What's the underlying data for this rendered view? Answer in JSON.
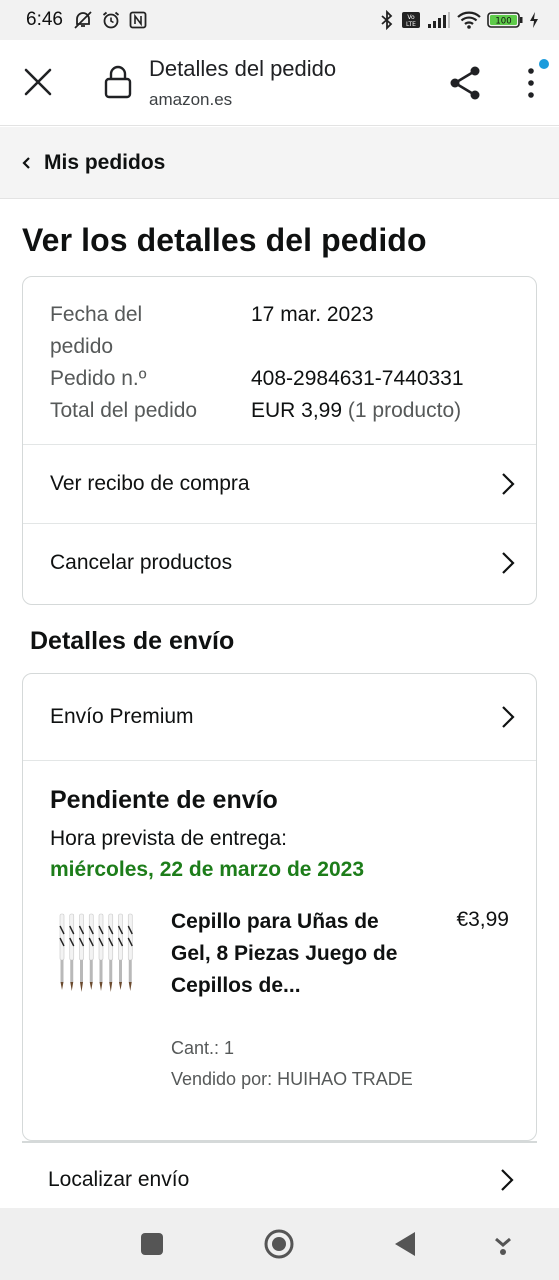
{
  "status_bar": {
    "time": "6:46",
    "battery": "100",
    "icons_left": [
      "mute-icon",
      "alarm-icon",
      "nfc-icon"
    ],
    "icons_right": [
      "bluetooth-icon",
      "volte-icon",
      "signal-icon",
      "wifi-icon",
      "battery-icon",
      "charging-icon"
    ]
  },
  "browser": {
    "title": "Detalles del pedido",
    "url": "amazon.es",
    "icons": [
      "close-icon",
      "lock-icon",
      "share-icon",
      "more-vert-icon"
    ]
  },
  "breadcrumb": {
    "label": "Mis pedidos"
  },
  "page_title": "Ver los detalles del pedido",
  "order_summary": {
    "date_label": "Fecha del pedido",
    "date_value": "17 mar. 2023",
    "number_label": "Pedido n.º",
    "number_value": "408-2984631-7440331",
    "total_label": "Total del pedido",
    "total_value": "EUR 3,99",
    "total_count": "(1 producto)"
  },
  "actions": {
    "receipt": "Ver recibo de compra",
    "cancel": "Cancelar productos"
  },
  "shipping": {
    "section_title": "Detalles de envío",
    "method": "Envío Premium",
    "status": "Pendiente de envío",
    "eta_label": "Hora prevista de entrega:",
    "eta_date": "miércoles, 22 de marzo de 2023",
    "status_color": "#1d7d1a"
  },
  "product": {
    "name": "Cepillo para Uñas de Gel, 8 Piezas Juego de Cepillos de...",
    "price": "€3,99",
    "quantity": "Cant.: 1",
    "seller": "Vendido por: HUIHAO TRADE",
    "brushes": 8
  },
  "tracking": {
    "label": "Localizar envío"
  },
  "nav_bar": {
    "buttons": [
      "square-icon",
      "home-circle-icon",
      "back-triangle-icon",
      "down-arrow-icon"
    ]
  }
}
